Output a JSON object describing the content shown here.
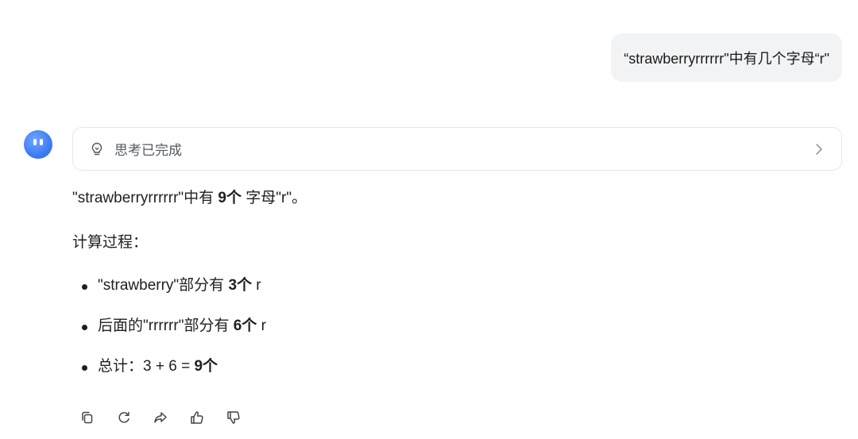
{
  "user_message": "“strawberryrrrrrr\"中有几个字母“r\"",
  "thinking": {
    "label": "思考已完成"
  },
  "answer": {
    "lead": {
      "pre": "\"strawberryrrrrrr\"中有 ",
      "bold": "9个",
      "post": " 字母\"r\"。"
    },
    "calc_title": "计算过程：",
    "bullets": [
      {
        "pre": "\"strawberry\"部分有 ",
        "bold": "3个",
        "post": " r"
      },
      {
        "pre": "后面的\"rrrrrr\"部分有 ",
        "bold": "6个",
        "post": " r"
      },
      {
        "pre": "总计：3 + 6 = ",
        "bold": "9个",
        "post": ""
      }
    ]
  },
  "actions": [
    {
      "name": "copy-icon"
    },
    {
      "name": "regenerate-icon"
    },
    {
      "name": "share-icon"
    },
    {
      "name": "thumbs-up-icon"
    },
    {
      "name": "thumbs-down-icon"
    }
  ]
}
